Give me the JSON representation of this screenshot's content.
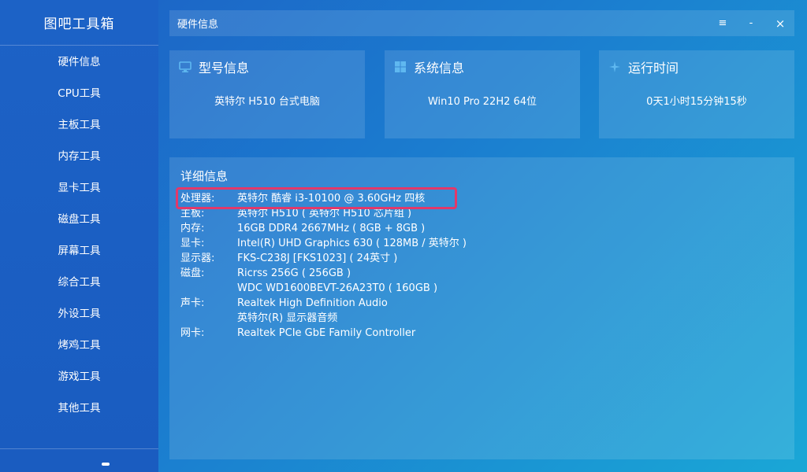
{
  "app": {
    "title": "图吧工具箱"
  },
  "sidebar": {
    "items": [
      {
        "label": "硬件信息"
      },
      {
        "label": "CPU工具"
      },
      {
        "label": "主板工具"
      },
      {
        "label": "内存工具"
      },
      {
        "label": "显卡工具"
      },
      {
        "label": "磁盘工具"
      },
      {
        "label": "屏幕工具"
      },
      {
        "label": "综合工具"
      },
      {
        "label": "外设工具"
      },
      {
        "label": "烤鸡工具"
      },
      {
        "label": "游戏工具"
      },
      {
        "label": "其他工具"
      }
    ]
  },
  "window": {
    "title": "硬件信息",
    "menu_glyph": "≡",
    "minimize_glyph": "-",
    "close_glyph": "×"
  },
  "cards": {
    "model": {
      "title": "型号信息",
      "value": "英特尔 H510 台式电脑",
      "icon": "monitor-icon"
    },
    "system": {
      "title": "系统信息",
      "value": "Win10 Pro 22H2 64位",
      "icon": "windows-logo-icon"
    },
    "uptime": {
      "title": "运行时间",
      "value": "0天1小时15分钟15秒",
      "icon": "sparkle-icon"
    }
  },
  "detail": {
    "title": "详细信息",
    "rows": [
      {
        "key": "处理器:",
        "value": "英特尔 酷睿 i3-10100 @ 3.60GHz 四核"
      },
      {
        "key": "主板:",
        "value": "英特尔 H510 ( 英特尔 H510 芯片组 )"
      },
      {
        "key": "内存:",
        "value": "16GB DDR4 2667MHz ( 8GB + 8GB )"
      },
      {
        "key": "显卡:",
        "value": "Intel(R) UHD Graphics 630 ( 128MB / 英特尔 )"
      },
      {
        "key": "显示器:",
        "value": "FKS-C238J [FKS1023] ( 24英寸 )"
      },
      {
        "key": "磁盘:",
        "value": "Ricrss 256G ( 256GB )"
      },
      {
        "key": "",
        "value": "WDC WD1600BEVT-26A23T0 ( 160GB )"
      },
      {
        "key": "声卡:",
        "value": "Realtek High Definition Audio"
      },
      {
        "key": "",
        "value": "英特尔(R) 显示器音频"
      },
      {
        "key": "网卡:",
        "value": "Realtek PCIe GbE Family Controller"
      }
    ]
  },
  "colors": {
    "highlight_border": "#e2386a",
    "accent_icon": "#5fb8f0"
  }
}
